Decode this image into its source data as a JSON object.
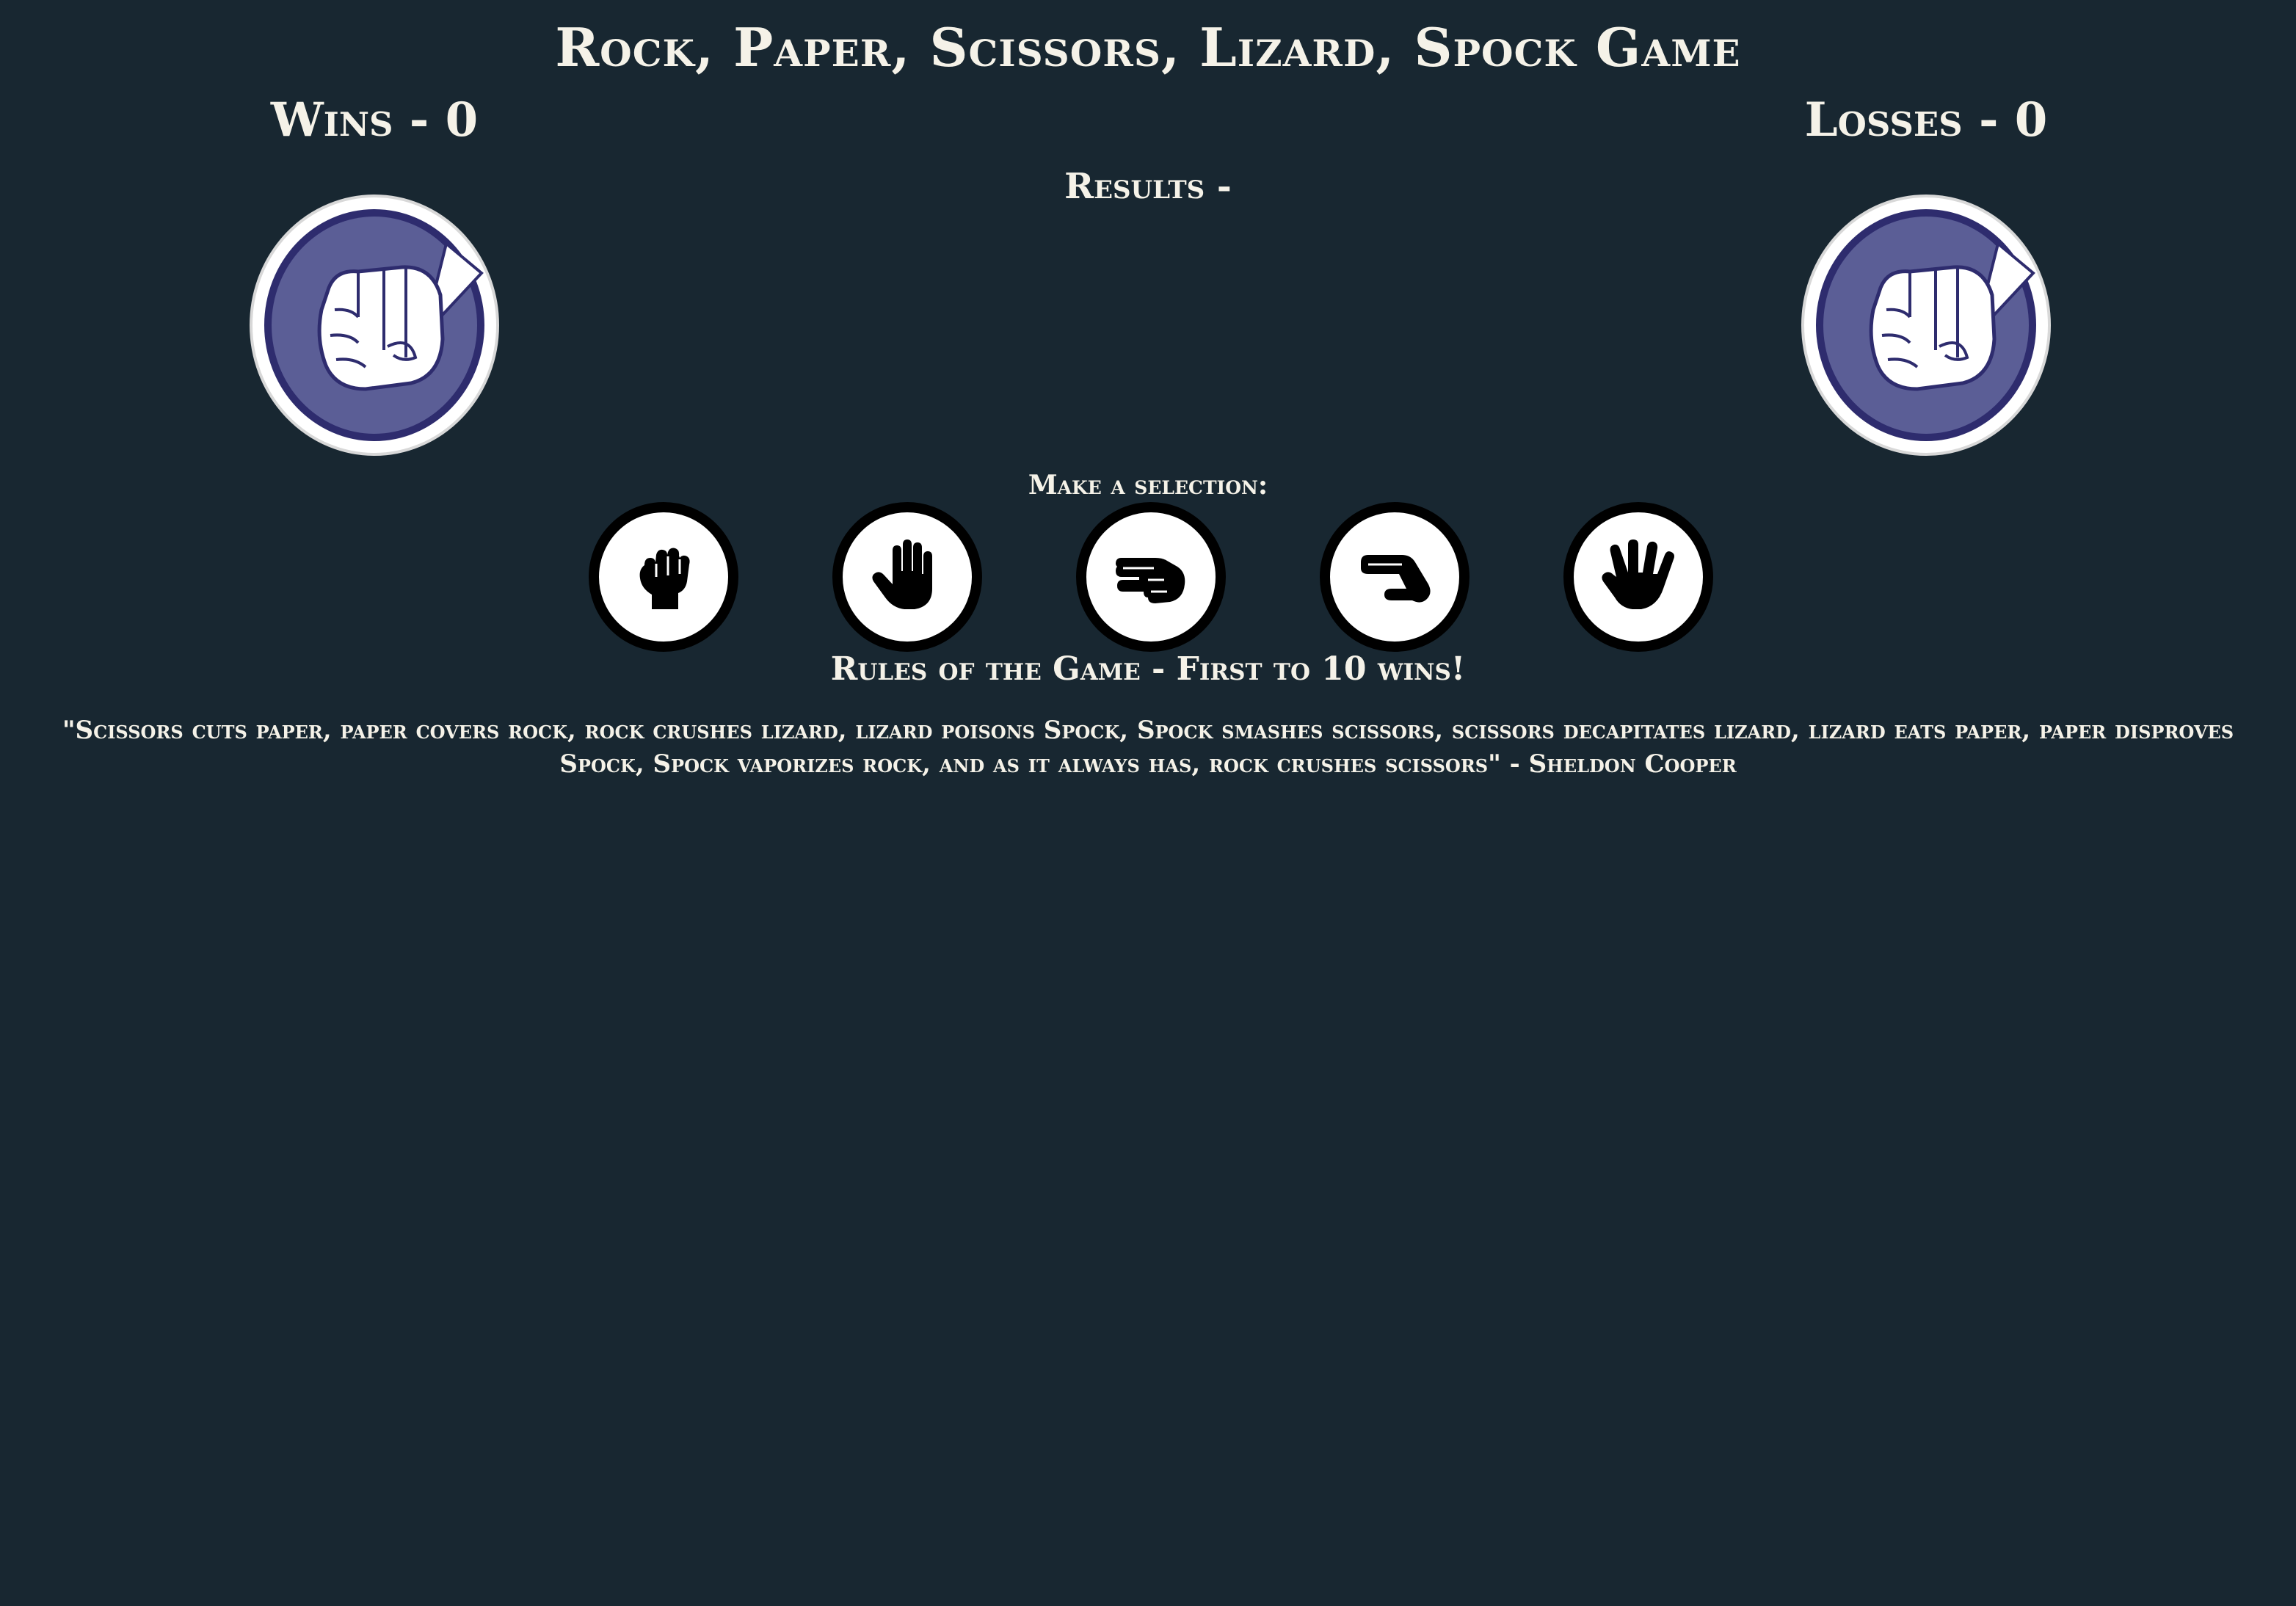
{
  "page": {
    "title": "Rock, Paper, Scissors, Lizard, Spock Game"
  },
  "scoreboard": {
    "wins_label": "Wins - 0",
    "losses_label": "Losses - 0"
  },
  "results": {
    "label": "Results -"
  },
  "hands": {
    "player_icon": "rock-fist-icon",
    "computer_icon": "rock-fist-icon",
    "circle_color": "#5b5e96",
    "ring_color": "#2e2c6e"
  },
  "selection": {
    "prompt": "Make a selection:",
    "options": [
      {
        "name": "rock",
        "icon": "rock-icon"
      },
      {
        "name": "paper",
        "icon": "paper-icon"
      },
      {
        "name": "scissors",
        "icon": "scissors-icon"
      },
      {
        "name": "lizard",
        "icon": "lizard-icon"
      },
      {
        "name": "spock",
        "icon": "spock-icon"
      }
    ]
  },
  "rules": {
    "heading": "Rules of the Game - First to 10 wins!",
    "quote": "\"Scissors cuts paper, paper covers rock, rock crushes lizard, lizard poisons Spock, Spock smashes scissors, scissors decapitates lizard, lizard eats paper, paper disproves Spock, Spock vaporizes rock, and as it always has, rock crushes scissors\" - Sheldon Cooper"
  },
  "colors": {
    "background": "#182731",
    "text": "#f5f2e8"
  }
}
